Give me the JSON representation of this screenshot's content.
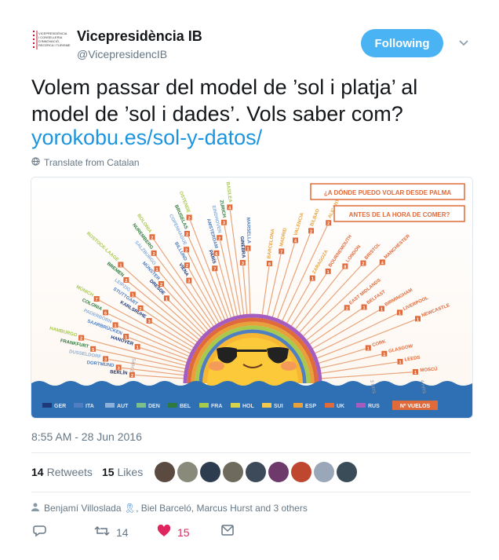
{
  "account": {
    "name": "Vicepresidència IB",
    "handle": "@VicepresidencIB",
    "logo_lines": [
      "VICEPRESIDÈNCIA",
      "I CONSELLERIA",
      "D'INNOVACIÓ,",
      "RECERCA I TURISME"
    ]
  },
  "follow_button": {
    "label": "Following",
    "color": "#4ab3f4"
  },
  "tweet": {
    "text": "Volem passar del model de ’sol i platja’ al model de ’sol i dades’. Vols saber com?",
    "link": "yorokobu.es/sol-y-datos/",
    "translate_label": "Translate from Catalan",
    "timestamp": "8:55 AM - 28 Jun 2016"
  },
  "media": {
    "question1": "¿A DÓNDE PUEDO VOLAR DESDE PALMA",
    "question2": "ANTES DE LA HORA DE COMER?",
    "cities_left": [
      "BERLÍN",
      "DORTMUND",
      "DUSSELDORF",
      "FRANKFURT",
      "HAMBURGO",
      "HANOVER",
      "SAARBRÜCKEN",
      "PADERBORN",
      "COLONIA",
      "MÚNICH",
      "KARLSRUHE",
      "STUTTGART",
      "LEIPZIG",
      "BREMEN",
      "ROSTOCK-LAAGE",
      "DRESDE",
      "MÜNSTER",
      "SALZBURGO",
      "NUREMBERG",
      "BOLONIA",
      "VIENA",
      "BILLUND",
      "COPENHAGUE",
      "BRUSELAS",
      "OSTENDE",
      "PARÍS",
      "AMSTERDAM",
      "EINDHOVEN",
      "ZURICH",
      "BASILEA",
      "GINEBRA",
      "MARSELLA"
    ],
    "cities_right": [
      "BARCELONA",
      "MADRID",
      "VALENCIA",
      "BILBAO",
      "ALICANTE",
      "ZARAGOZA",
      "BOURNEMOUTH",
      "LONDON",
      "BRISTOL",
      "MANCHESTER",
      "EAST MIDLANDS",
      "BELFAST",
      "BIRMINGHAM",
      "LIVERPOOL",
      "NEWCASTLE",
      "CORK",
      "GLASGOW",
      "LEEDS",
      "MOSCÚ"
    ],
    "flight_counts_left": [
      "2",
      "3",
      "3",
      "5",
      "2",
      "1",
      "1",
      "1",
      "6",
      "7",
      "3",
      "2",
      "1",
      "2",
      "1",
      "1",
      "2",
      "1",
      "2",
      "2",
      "3",
      "2",
      "2",
      "2",
      "2",
      "7",
      "6",
      "2",
      "3",
      "4",
      "3",
      "1"
    ],
    "flight_counts_right": [
      "8",
      "7",
      "4",
      "2",
      "2",
      "1",
      "1",
      "8",
      "2",
      "4",
      "2",
      "1",
      "1",
      "1",
      "1",
      "1",
      "1",
      "1",
      "1"
    ],
    "hour_labels": [
      "2 HRS",
      "3 HRS",
      "4 HRS"
    ],
    "legend": [
      {
        "label": "GER",
        "color": "#1e3a7a"
      },
      {
        "label": "ITA",
        "color": "#4f7fc0"
      },
      {
        "label": "AUT",
        "color": "#8bb0dc"
      },
      {
        "label": "DEN",
        "color": "#7bbf8a"
      },
      {
        "label": "BEL",
        "color": "#2e7a3c"
      },
      {
        "label": "FRA",
        "color": "#a7c94e"
      },
      {
        "label": "HOL",
        "color": "#d9d34a"
      },
      {
        "label": "SUI",
        "color": "#f2c94c"
      },
      {
        "label": "ESP",
        "color": "#e8a13a"
      },
      {
        "label": "UK",
        "color": "#e06a3a"
      },
      {
        "label": "RUS",
        "color": "#a55ec0"
      }
    ],
    "legend_last": "Nº VUELOS"
  },
  "stats": {
    "retweets_count": "14",
    "retweets_label": "Retweets",
    "likes_count": "15",
    "likes_label": "Likes",
    "avatar_colors": [
      "#5b4a3f",
      "#8a8a7a",
      "#2d3d4f",
      "#6f6a5e",
      "#3d4a5a",
      "#6d3a6b",
      "#c0472f",
      "#9aa7b8",
      "#3a4c58"
    ]
  },
  "replies": {
    "text": "Benjamí Villoslada",
    "rest": ", Biel Barceló, Marcus Hurst and 3 others"
  },
  "actions": {
    "retweet_count": "14",
    "like_count": "15"
  }
}
